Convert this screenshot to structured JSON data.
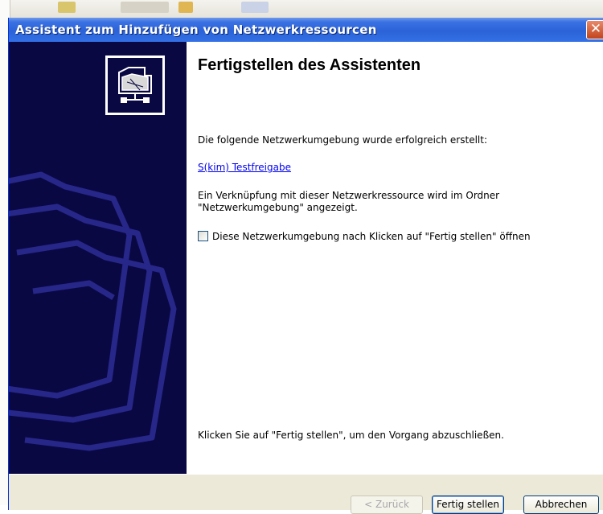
{
  "window": {
    "title": "Assistent zum Hinzufügen von Netzwerkressourcen",
    "close_label": "✕"
  },
  "content": {
    "heading": "Fertigstellen des Assistenten",
    "created_text": "Die folgende Netzwerkumgebung wurde erfolgreich erstellt:",
    "resource_link": "S(kim) Testfreigabe",
    "shortcut_info_line1": "Ein Verknüpfung mit dieser Netzwerkressource wird im Ordner",
    "shortcut_info_line2": "\"Netzwerkumgebung\" angezeigt.",
    "open_checkbox_label": "Diese Netzwerkumgebung nach Klicken auf \"Fertig stellen\" öffnen",
    "open_checkbox_checked": false,
    "finish_hint": "Klicken Sie auf \"Fertig stellen\", um den Vorgang abzuschließen."
  },
  "buttons": {
    "back": "< Zurück",
    "finish": "Fertig stellen",
    "cancel": "Abbrechen"
  },
  "icons": {
    "wizard": "network-folder-icon",
    "close": "close-icon",
    "side_art": "folder-outline-art"
  },
  "colors": {
    "titlebar": "#2b62d8",
    "side_panel": "#0a0843",
    "side_art_stroke": "#27278a",
    "dialog_face": "#ece9d8",
    "close_button": "#c1441c",
    "link": "#0000ee"
  }
}
